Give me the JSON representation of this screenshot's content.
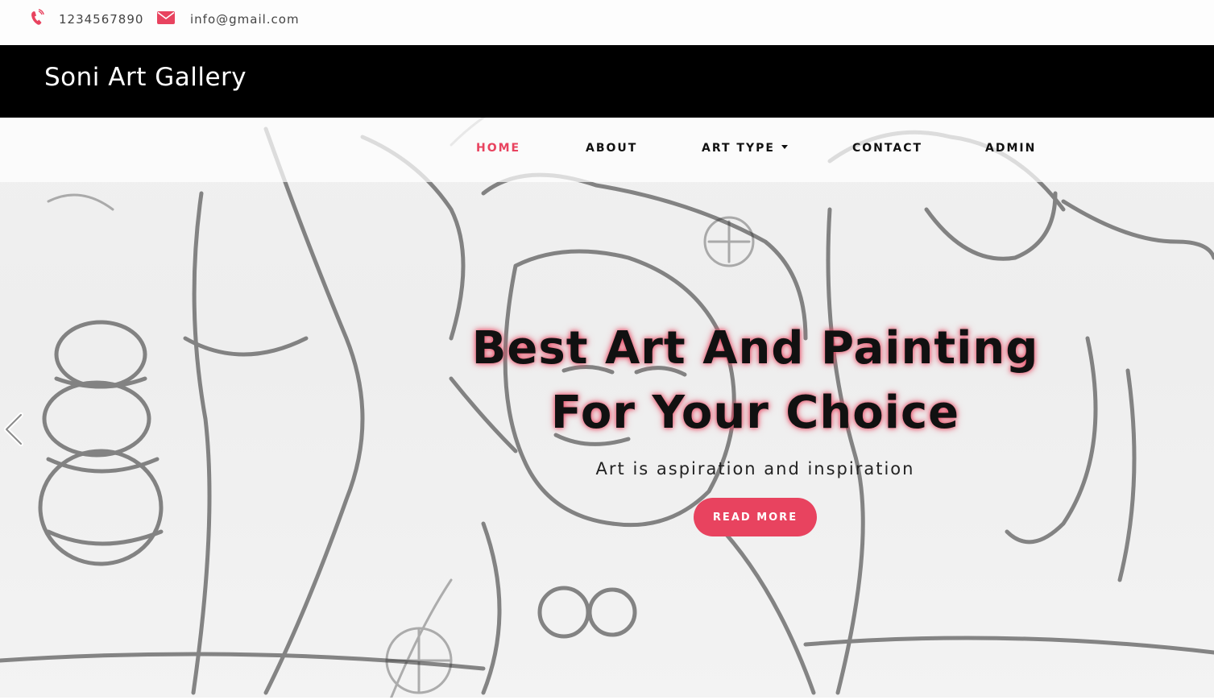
{
  "contact": {
    "phone": "1234567890",
    "email": "info@gmail.com",
    "phone_icon": "phone-icon",
    "email_icon": "envelope-icon"
  },
  "brand": {
    "name": "Soni Art Gallery"
  },
  "nav": {
    "items": [
      {
        "label": "HOME",
        "active": true
      },
      {
        "label": "ABOUT",
        "active": false
      },
      {
        "label": "ART TYPE",
        "active": false,
        "dropdown": true
      },
      {
        "label": "CONTACT",
        "active": false
      },
      {
        "label": "ADMIN",
        "active": false
      }
    ]
  },
  "hero": {
    "title_line1": "Best Art And Painting",
    "title_line2": "For Your Choice",
    "subtitle": "Art is aspiration and inspiration",
    "button_label": "READ MORE",
    "prev_icon": "chevron-left-icon"
  },
  "colors": {
    "accent": "#e8435f",
    "brand_bar": "#000000",
    "text_dark": "#111111"
  }
}
